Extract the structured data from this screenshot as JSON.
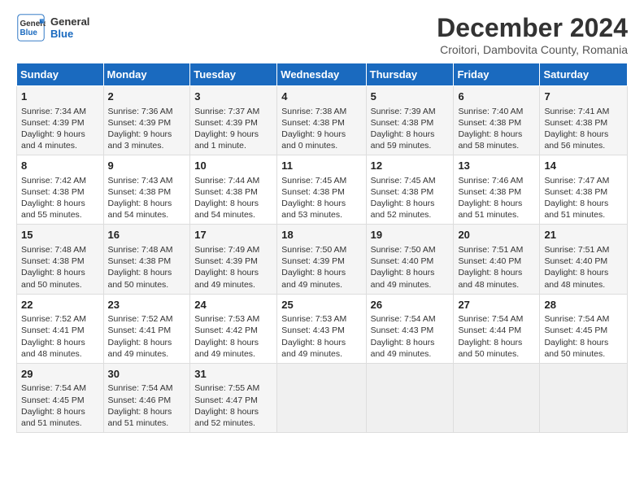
{
  "header": {
    "logo_line1": "General",
    "logo_line2": "Blue",
    "title": "December 2024",
    "subtitle": "Croitori, Dambovita County, Romania"
  },
  "days_of_week": [
    "Sunday",
    "Monday",
    "Tuesday",
    "Wednesday",
    "Thursday",
    "Friday",
    "Saturday"
  ],
  "weeks": [
    [
      {
        "day": "1",
        "info": "Sunrise: 7:34 AM\nSunset: 4:39 PM\nDaylight: 9 hours\nand 4 minutes."
      },
      {
        "day": "2",
        "info": "Sunrise: 7:36 AM\nSunset: 4:39 PM\nDaylight: 9 hours\nand 3 minutes."
      },
      {
        "day": "3",
        "info": "Sunrise: 7:37 AM\nSunset: 4:39 PM\nDaylight: 9 hours\nand 1 minute."
      },
      {
        "day": "4",
        "info": "Sunrise: 7:38 AM\nSunset: 4:38 PM\nDaylight: 9 hours\nand 0 minutes."
      },
      {
        "day": "5",
        "info": "Sunrise: 7:39 AM\nSunset: 4:38 PM\nDaylight: 8 hours\nand 59 minutes."
      },
      {
        "day": "6",
        "info": "Sunrise: 7:40 AM\nSunset: 4:38 PM\nDaylight: 8 hours\nand 58 minutes."
      },
      {
        "day": "7",
        "info": "Sunrise: 7:41 AM\nSunset: 4:38 PM\nDaylight: 8 hours\nand 56 minutes."
      }
    ],
    [
      {
        "day": "8",
        "info": "Sunrise: 7:42 AM\nSunset: 4:38 PM\nDaylight: 8 hours\nand 55 minutes."
      },
      {
        "day": "9",
        "info": "Sunrise: 7:43 AM\nSunset: 4:38 PM\nDaylight: 8 hours\nand 54 minutes."
      },
      {
        "day": "10",
        "info": "Sunrise: 7:44 AM\nSunset: 4:38 PM\nDaylight: 8 hours\nand 54 minutes."
      },
      {
        "day": "11",
        "info": "Sunrise: 7:45 AM\nSunset: 4:38 PM\nDaylight: 8 hours\nand 53 minutes."
      },
      {
        "day": "12",
        "info": "Sunrise: 7:45 AM\nSunset: 4:38 PM\nDaylight: 8 hours\nand 52 minutes."
      },
      {
        "day": "13",
        "info": "Sunrise: 7:46 AM\nSunset: 4:38 PM\nDaylight: 8 hours\nand 51 minutes."
      },
      {
        "day": "14",
        "info": "Sunrise: 7:47 AM\nSunset: 4:38 PM\nDaylight: 8 hours\nand 51 minutes."
      }
    ],
    [
      {
        "day": "15",
        "info": "Sunrise: 7:48 AM\nSunset: 4:38 PM\nDaylight: 8 hours\nand 50 minutes."
      },
      {
        "day": "16",
        "info": "Sunrise: 7:48 AM\nSunset: 4:38 PM\nDaylight: 8 hours\nand 50 minutes."
      },
      {
        "day": "17",
        "info": "Sunrise: 7:49 AM\nSunset: 4:39 PM\nDaylight: 8 hours\nand 49 minutes."
      },
      {
        "day": "18",
        "info": "Sunrise: 7:50 AM\nSunset: 4:39 PM\nDaylight: 8 hours\nand 49 minutes."
      },
      {
        "day": "19",
        "info": "Sunrise: 7:50 AM\nSunset: 4:40 PM\nDaylight: 8 hours\nand 49 minutes."
      },
      {
        "day": "20",
        "info": "Sunrise: 7:51 AM\nSunset: 4:40 PM\nDaylight: 8 hours\nand 48 minutes."
      },
      {
        "day": "21",
        "info": "Sunrise: 7:51 AM\nSunset: 4:40 PM\nDaylight: 8 hours\nand 48 minutes."
      }
    ],
    [
      {
        "day": "22",
        "info": "Sunrise: 7:52 AM\nSunset: 4:41 PM\nDaylight: 8 hours\nand 48 minutes."
      },
      {
        "day": "23",
        "info": "Sunrise: 7:52 AM\nSunset: 4:41 PM\nDaylight: 8 hours\nand 49 minutes."
      },
      {
        "day": "24",
        "info": "Sunrise: 7:53 AM\nSunset: 4:42 PM\nDaylight: 8 hours\nand 49 minutes."
      },
      {
        "day": "25",
        "info": "Sunrise: 7:53 AM\nSunset: 4:43 PM\nDaylight: 8 hours\nand 49 minutes."
      },
      {
        "day": "26",
        "info": "Sunrise: 7:54 AM\nSunset: 4:43 PM\nDaylight: 8 hours\nand 49 minutes."
      },
      {
        "day": "27",
        "info": "Sunrise: 7:54 AM\nSunset: 4:44 PM\nDaylight: 8 hours\nand 50 minutes."
      },
      {
        "day": "28",
        "info": "Sunrise: 7:54 AM\nSunset: 4:45 PM\nDaylight: 8 hours\nand 50 minutes."
      }
    ],
    [
      {
        "day": "29",
        "info": "Sunrise: 7:54 AM\nSunset: 4:45 PM\nDaylight: 8 hours\nand 51 minutes."
      },
      {
        "day": "30",
        "info": "Sunrise: 7:54 AM\nSunset: 4:46 PM\nDaylight: 8 hours\nand 51 minutes."
      },
      {
        "day": "31",
        "info": "Sunrise: 7:55 AM\nSunset: 4:47 PM\nDaylight: 8 hours\nand 52 minutes."
      },
      {
        "day": "",
        "info": ""
      },
      {
        "day": "",
        "info": ""
      },
      {
        "day": "",
        "info": ""
      },
      {
        "day": "",
        "info": ""
      }
    ]
  ]
}
